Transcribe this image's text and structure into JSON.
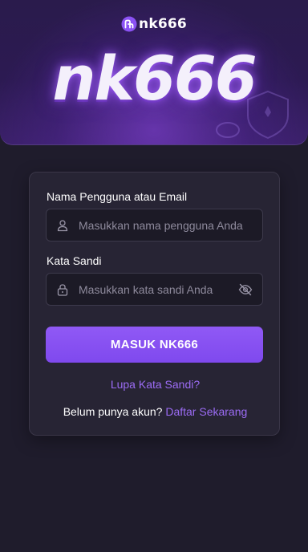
{
  "header": {
    "logo_text": "nk666",
    "banner_title": "nk666"
  },
  "form": {
    "username_label": "Nama Pengguna atau Email",
    "username_placeholder": "Masukkan nama pengguna Anda",
    "password_label": "Kata Sandi",
    "password_placeholder": "Masukkan kata sandi Anda",
    "submit_label": "MASUK NK666",
    "forgot_label": "Lupa Kata Sandi?",
    "register_prompt": "Belum punya akun?",
    "register_link": "Daftar Sekarang"
  },
  "icons": {
    "logo": "nk-logo-icon",
    "user": "user-icon",
    "lock": "lock-icon",
    "toggle_password": "eye-off-icon"
  },
  "colors": {
    "accent": "#8b52f4",
    "link": "#9c6cf5",
    "background": "#1f1c2c",
    "card": "#272434"
  }
}
